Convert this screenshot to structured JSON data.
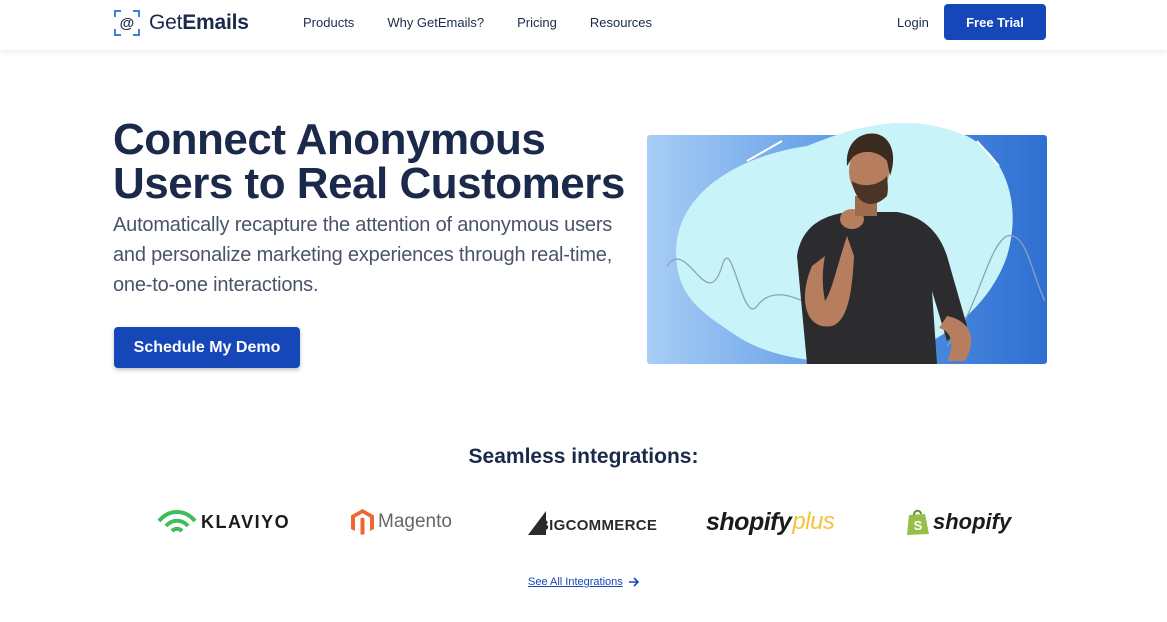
{
  "header": {
    "logo": {
      "prefix": "Get",
      "bold": "Emails"
    },
    "nav": [
      "Products",
      "Why GetEmails?",
      "Pricing",
      "Resources"
    ],
    "login": "Login",
    "free_trial": "Free Trial"
  },
  "hero": {
    "title": "Connect Anonymous Users to Real Customers",
    "subtitle": "Automatically recapture the attention of anonymous users and personalize marketing experiences through real-time, one-to-one interactions.",
    "cta": "Schedule My Demo"
  },
  "integrations": {
    "title": "Seamless integrations:",
    "brands": [
      "KLAVIYO",
      "Magento",
      "BIGCOMMERCE",
      "shopify",
      "plus",
      "shopify"
    ],
    "see_all": "See All Integrations"
  },
  "colors": {
    "primary": "#1547b8",
    "heading": "#1b2a4a",
    "body": "#4a5468",
    "klaviyo_green": "#3dbd5c",
    "magento_orange": "#ee672f"
  }
}
